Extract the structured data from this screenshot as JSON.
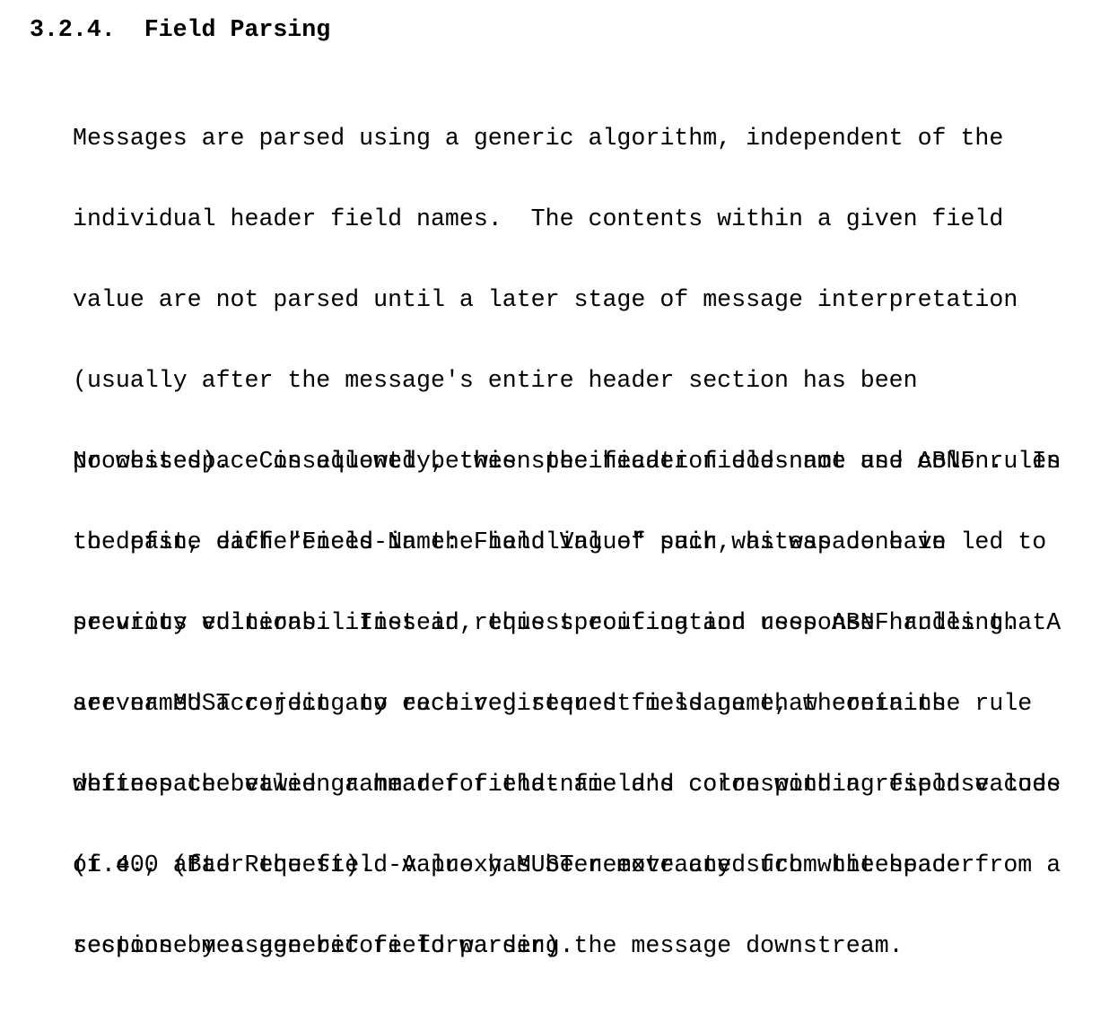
{
  "section": {
    "number": "3.2.4.",
    "title": "Field Parsing"
  },
  "paragraphs": [
    {
      "lines": [
        "Messages are parsed using a generic algorithm, independent of the",
        "individual header field names.  The contents within a given field",
        "value are not parsed until a later stage of message interpretation",
        "(usually after the message's entire header section has been",
        "processed).  Consequently, this specification does not use ABNF rules",
        "to define each \"Field-Name: Field Value\" pair, as was done in",
        "previous editions.  Instead, this specification uses ABNF rules that",
        "are named according to each registered field name, wherein the rule",
        "defines the valid grammar for that field's corresponding field values",
        "(i.e., after the field-value has been extracted from the header",
        "section by a generic field parser)."
      ]
    },
    {
      "lines": [
        "No whitespace is allowed between the header field-name and colon.  In",
        "the past, differences in the handling of such whitespace have led to",
        "security vulnerabilities in request routing and response handling.  A",
        "server MUST reject any received request message that contains",
        "whitespace between a header field-name and colon with a response code",
        "of 400 (Bad Request).  A proxy MUST remove any such whitespace from a",
        "response message before forwarding the message downstream."
      ]
    }
  ]
}
